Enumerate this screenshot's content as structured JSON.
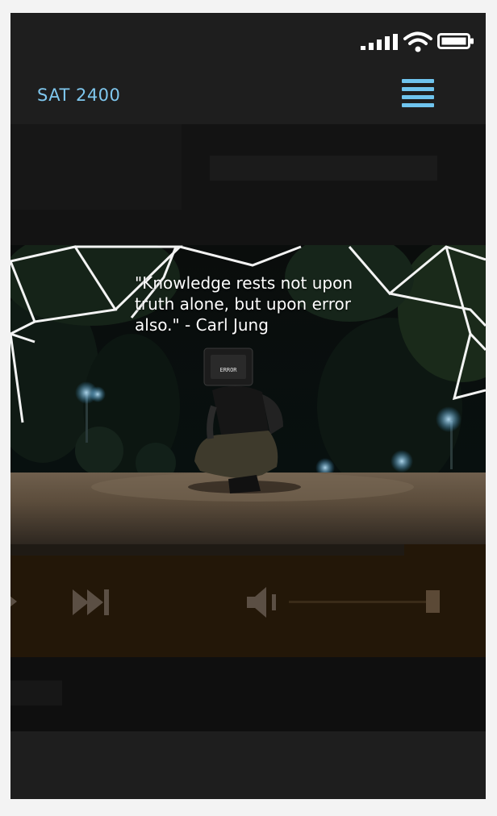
{
  "app": {
    "title": "SAT 2400"
  },
  "status_bar": {
    "icons": [
      "signal-icon",
      "wifi-icon",
      "battery-icon"
    ]
  },
  "header": {
    "menu_icon": "hamburger-menu-icon"
  },
  "hero": {
    "quote": "\"Knowledge rests not upon truth alone, but upon error also.\" - Carl Jung",
    "monitor_label": "ERROR"
  },
  "player": {
    "controls": [
      "previous-icon",
      "next-track-icon",
      "volume-icon"
    ],
    "volume_level": 1.0
  },
  "colors": {
    "accent": "#6fc4ee",
    "background": "#1d1d1d",
    "player_background": "#231708"
  }
}
